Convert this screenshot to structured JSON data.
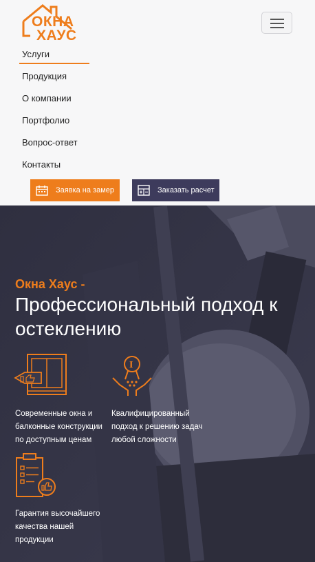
{
  "brand": {
    "line1": "ОКНА",
    "line2": "ХАУС",
    "color": "#ee7d1c"
  },
  "nav": {
    "items": [
      {
        "label": "Услуги"
      },
      {
        "label": "Продукция"
      },
      {
        "label": "О компании"
      },
      {
        "label": "Портфолио"
      },
      {
        "label": "Вопрос-ответ"
      },
      {
        "label": "Контакты"
      }
    ],
    "active": "Услуги"
  },
  "actions": {
    "measure_label": "Заявка на замер",
    "calc_label": "Заказать расчет"
  },
  "hero": {
    "brand_line": "Окна Хаус -",
    "headline": "Профессиональный подход к остеклению"
  },
  "features": [
    {
      "icon": "window-thumbs-up-icon",
      "text": "Современные окна и балконные конструкции по доступным ценам"
    },
    {
      "icon": "award-hands-icon",
      "text": "Квалифицированный подход к решению задач любой сложности"
    },
    {
      "icon": "checklist-clipboard-icon",
      "text": "Гарантия высочайшего качества нашей продукции"
    }
  ],
  "colors": {
    "accent": "#ee7d1c",
    "navy": "#3d3b5c",
    "hero_bg": "#3a3a4d"
  }
}
